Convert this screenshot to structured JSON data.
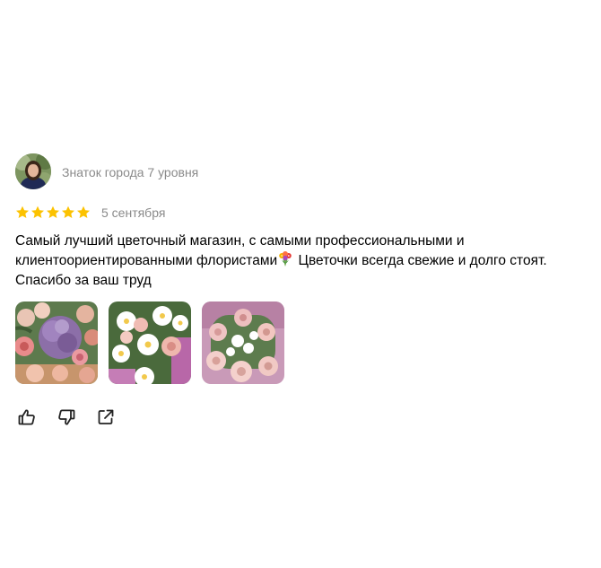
{
  "review": {
    "author_level": "Знаток города 7 уровня",
    "rating": 5,
    "rating_max": 5,
    "star_color": "#fcc200",
    "date": "5 сентября",
    "text_part1": "Самый лучший цветочный магазин, с самыми профессиональными и клиентоориентированными флористами",
    "text_part2": " Цветочки всегда свежие и долго стоят. Спасибо за ваш труд",
    "emoji_icon": "bouquet-icon",
    "photos": [
      {
        "name": "photo-bouquet-hydrangea"
      },
      {
        "name": "photo-bouquet-daisies"
      },
      {
        "name": "photo-bouquet-roses"
      }
    ],
    "actions": [
      {
        "name": "like-button",
        "icon": "thumbs-up-icon"
      },
      {
        "name": "dislike-button",
        "icon": "thumbs-down-icon"
      },
      {
        "name": "share-button",
        "icon": "share-icon"
      }
    ]
  }
}
